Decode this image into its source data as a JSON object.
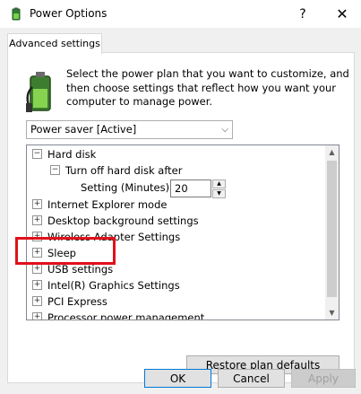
{
  "window": {
    "title": "Power Options",
    "help_label": "?",
    "close_label": "✕"
  },
  "tab": {
    "label": "Advanced settings"
  },
  "description": "Select the power plan that you want to customize, and then choose settings that reflect how you want your computer to manage power.",
  "plan_select": {
    "value": "Power saver [Active]",
    "arrow": "⌵"
  },
  "tree": {
    "hard_disk": {
      "expander": "−",
      "label": "Hard disk"
    },
    "turn_off_hard_disk": {
      "expander": "−",
      "label": "Turn off hard disk after"
    },
    "setting": {
      "label": "Setting (Minutes):",
      "value": "20"
    },
    "items": [
      {
        "expander": "+",
        "label": "Internet Explorer mode"
      },
      {
        "expander": "+",
        "label": "Desktop background settings"
      },
      {
        "expander": "+",
        "label": "Wireless Adapter Settings"
      },
      {
        "expander": "+",
        "label": "Sleep"
      },
      {
        "expander": "+",
        "label": "USB settings"
      },
      {
        "expander": "+",
        "label": "Intel(R) Graphics Settings"
      },
      {
        "expander": "+",
        "label": "PCI Express"
      },
      {
        "expander": "+",
        "label": "Processor power management"
      }
    ]
  },
  "buttons": {
    "restore": "Restore plan defaults",
    "ok": "OK",
    "cancel": "Cancel",
    "apply": "Apply"
  },
  "highlight_color": "#e0111b"
}
